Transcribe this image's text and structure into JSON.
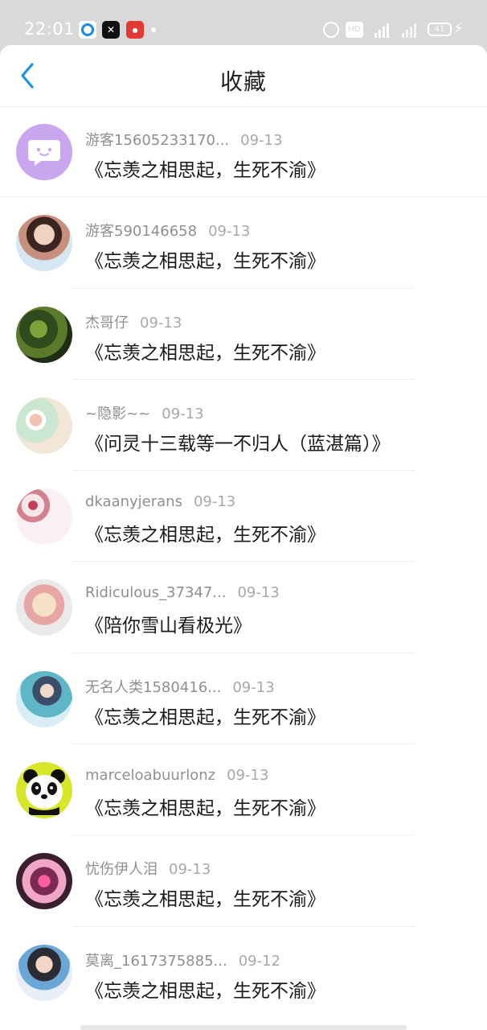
{
  "status_bar": {
    "time": "22:01",
    "network": "4G",
    "hd_label": "HD",
    "battery": "41"
  },
  "header": {
    "title": "收藏",
    "back_icon": "chevron-left-icon",
    "accent_color": "#1e90e6"
  },
  "favorites": [
    {
      "user": "游客15605233170...",
      "date": "09-13",
      "title": "《忘羡之相思起，生死不渝》",
      "avatar": "chat-bubble"
    },
    {
      "user": "游客590146658",
      "date": "09-13",
      "title": "《忘羡之相思起，生死不渝》",
      "avatar": "photo"
    },
    {
      "user": "杰哥仔",
      "date": "09-13",
      "title": "《忘羡之相思起，生死不渝》",
      "avatar": "photo"
    },
    {
      "user": "~隐影~~",
      "date": "09-13",
      "title": "《问灵十三载等一不归人（蓝湛篇）》",
      "avatar": "photo"
    },
    {
      "user": "dkaanyjerans",
      "date": "09-13",
      "title": "《忘羡之相思起，生死不渝》",
      "avatar": "photo"
    },
    {
      "user": "Ridiculous_37347...",
      "date": "09-13",
      "title": "《陪你雪山看极光》",
      "avatar": "photo"
    },
    {
      "user": "无名人类1580416...",
      "date": "09-13",
      "title": "《忘羡之相思起，生死不渝》",
      "avatar": "photo"
    },
    {
      "user": "marceloabuurlonz",
      "date": "09-13",
      "title": "《忘羡之相思起，生死不渝》",
      "avatar": "panda"
    },
    {
      "user": "忧伤伊人泪",
      "date": "09-13",
      "title": "《忘羡之相思起，生死不渝》",
      "avatar": "photo"
    },
    {
      "user": "莫离_1617375885...",
      "date": "09-12",
      "title": "《忘羡之相思起，生死不渝》",
      "avatar": "photo"
    }
  ]
}
